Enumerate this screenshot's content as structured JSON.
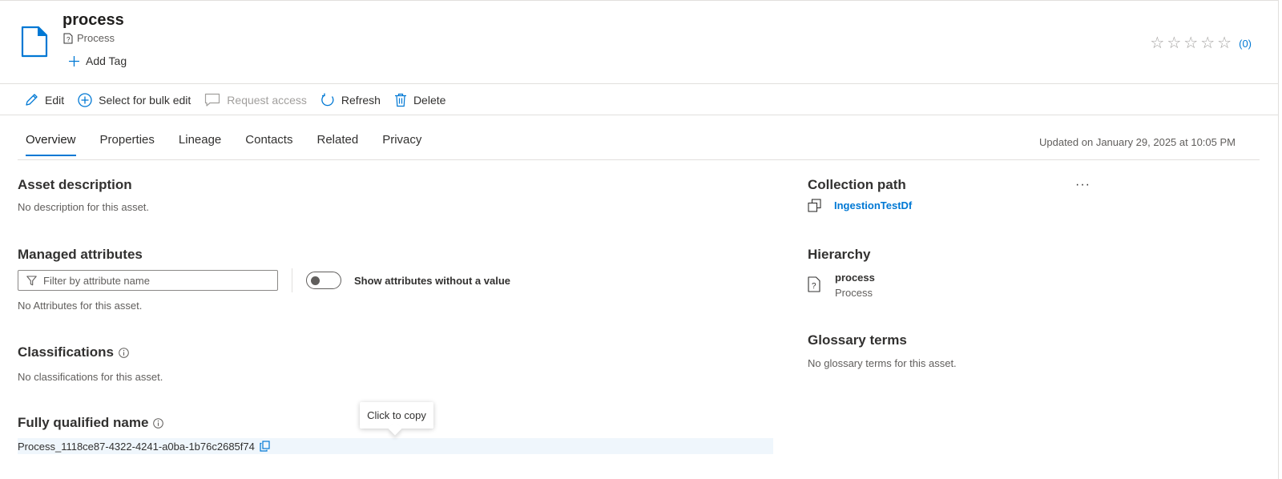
{
  "asset": {
    "title": "process",
    "type_label": "Process",
    "add_tag_label": "Add Tag",
    "rating_count": "(0)",
    "stars": 0,
    "stars_max": 5
  },
  "toolbar": {
    "edit": "Edit",
    "bulk_edit": "Select for bulk edit",
    "request_access": "Request access",
    "refresh": "Refresh",
    "delete": "Delete"
  },
  "tabs": [
    "Overview",
    "Properties",
    "Lineage",
    "Contacts",
    "Related",
    "Privacy"
  ],
  "updated_text": "Updated on January 29, 2025 at 10:05 PM",
  "left": {
    "description_title": "Asset description",
    "description_text": "No description for this asset.",
    "managed_title": "Managed attributes",
    "filter_placeholder": "Filter by attribute name",
    "toggle_label": "Show attributes without a value",
    "toggle_on": false,
    "no_attributes": "No Attributes for this asset.",
    "classifications_title": "Classifications",
    "classifications_text": "No classifications for this asset.",
    "fqn_title": "Fully qualified name",
    "fqn_value": "Process_1118ce87-4322-4241-a0ba-1b76c2685f74",
    "tooltip": "Click to copy"
  },
  "right": {
    "collection_title": "Collection path",
    "collection_link": "IngestionTestDf",
    "more_label": "···",
    "hierarchy_title": "Hierarchy",
    "hierarchy_name": "process",
    "hierarchy_type": "Process",
    "glossary_title": "Glossary terms",
    "glossary_text": "No glossary terms for this asset."
  },
  "colors": {
    "accent": "#0078d4",
    "text": "#323130",
    "muted": "#605e5c",
    "border": "#e1dfdd",
    "highlight": "#eff6fc"
  }
}
